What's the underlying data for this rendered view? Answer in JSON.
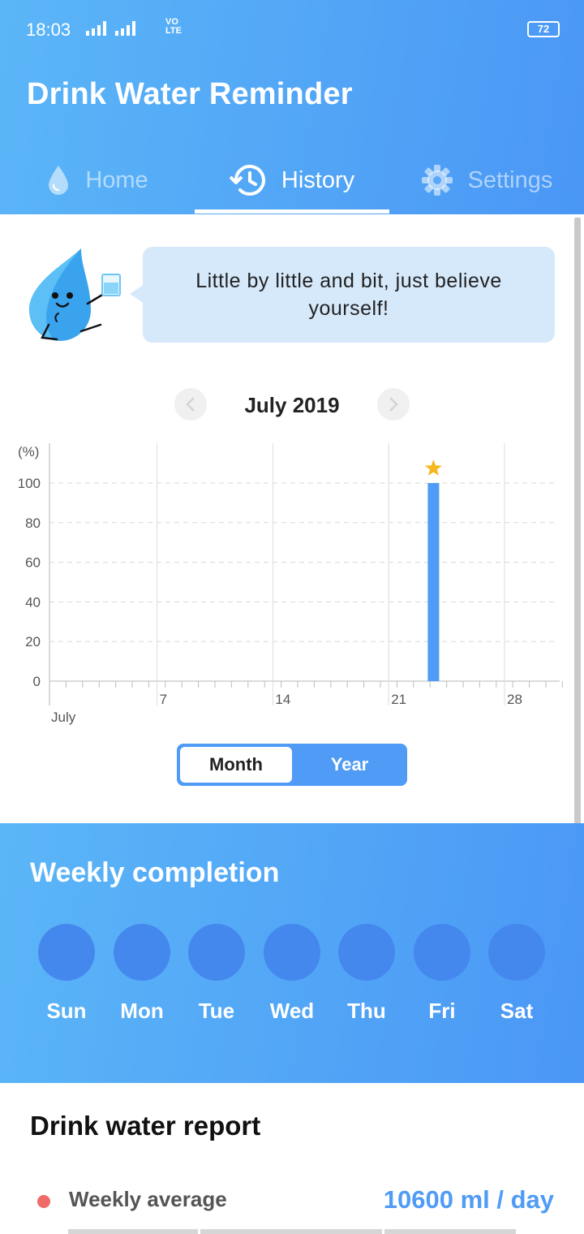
{
  "status": {
    "time": "18:03",
    "volte_top": "VO",
    "volte_bottom": "LTE",
    "battery": "72"
  },
  "app": {
    "title": "Drink Water Reminder"
  },
  "tabs": [
    {
      "label": "Home",
      "icon": "water-drop-icon",
      "active": false
    },
    {
      "label": "History",
      "icon": "history-clock-icon",
      "active": true
    },
    {
      "label": "Settings",
      "icon": "gear-icon",
      "active": false
    }
  ],
  "motivation": {
    "text": "Little by little and bit, just believe yourself!"
  },
  "history": {
    "month_label": "July 2019",
    "prev_icon": "chevron-left-icon",
    "next_icon": "chevron-right-icon"
  },
  "chart_data": {
    "type": "bar",
    "ylabel": "(%)",
    "xlabel": "July",
    "ylim": [
      0,
      100
    ],
    "y_ticks": [
      0,
      20,
      40,
      60,
      80,
      100
    ],
    "x_ticks": [
      7,
      14,
      21,
      28
    ],
    "x_range": [
      1,
      31
    ],
    "grid": true,
    "bars": [
      {
        "day": 24,
        "value": 100,
        "marker": "star-icon"
      }
    ]
  },
  "toggle": {
    "month_label": "Month",
    "year_label": "Year",
    "selected": "Month"
  },
  "weekly": {
    "title": "Weekly completion",
    "days": [
      "Sun",
      "Mon",
      "Tue",
      "Wed",
      "Thu",
      "Fri",
      "Sat"
    ]
  },
  "report": {
    "title": "Drink water report",
    "weekly_average_label": "Weekly average",
    "weekly_average_value": "10600 ml / day"
  },
  "colors": {
    "accent": "#4f9bf5",
    "header_start": "#5bb6f7",
    "header_end": "#4a97f6",
    "star": "#f5b820",
    "dot": "#f06a6a"
  }
}
